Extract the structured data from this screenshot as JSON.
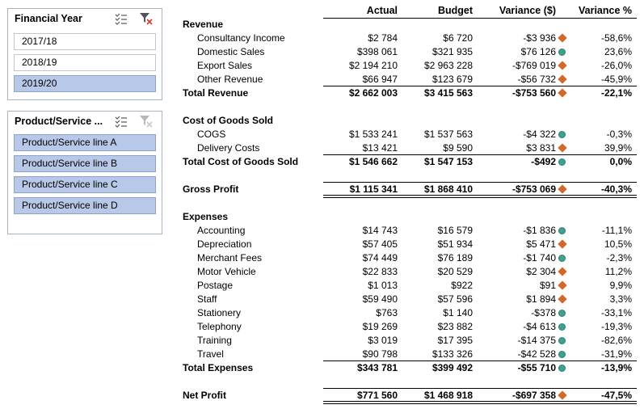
{
  "slicers": [
    {
      "title": "Financial Year",
      "items": [
        {
          "label": "2017/18",
          "selected": false
        },
        {
          "label": "2018/19",
          "selected": false
        },
        {
          "label": "2019/20",
          "selected": true
        }
      ]
    },
    {
      "title": "Product/Service ...",
      "items": [
        {
          "label": "Product/Service line A",
          "selected": true
        },
        {
          "label": "Product/Service line B",
          "selected": true
        },
        {
          "label": "Product/Service line C",
          "selected": true
        },
        {
          "label": "Product/Service line D",
          "selected": true
        }
      ]
    }
  ],
  "columns": {
    "actual": "Actual",
    "budget": "Budget",
    "variance": "Variance ($)",
    "variance_pct": "Variance %"
  },
  "indicator_colors": {
    "diamond": "#d0692b",
    "circle": "#41a18e"
  },
  "rows": [
    {
      "type": "section",
      "label": "Revenue"
    },
    {
      "type": "item",
      "label": "Consultancy Income",
      "actual": "$2 784",
      "budget": "$6 720",
      "variance": "-$3 936",
      "indicator": "diamond",
      "pct": "-58,6%"
    },
    {
      "type": "item",
      "label": "Domestic Sales",
      "actual": "$398 061",
      "budget": "$321 935",
      "variance": "$76 126",
      "indicator": "circle",
      "pct": "23,6%"
    },
    {
      "type": "item",
      "label": "Export Sales",
      "actual": "$2 194 210",
      "budget": "$2 963 228",
      "variance": "-$769 019",
      "indicator": "diamond",
      "pct": "-26,0%"
    },
    {
      "type": "item",
      "label": "Other Revenue",
      "actual": "$66 947",
      "budget": "$123 679",
      "variance": "-$56 732",
      "indicator": "diamond",
      "pct": "-45,9%"
    },
    {
      "type": "total",
      "label": "Total Revenue",
      "actual": "$2 662 003",
      "budget": "$3 415 563",
      "variance": "-$753 560",
      "indicator": "diamond",
      "pct": "-22,1%"
    },
    {
      "type": "section",
      "label": "Cost of Goods Sold"
    },
    {
      "type": "item",
      "label": "COGS",
      "actual": "$1 533 241",
      "budget": "$1 537 563",
      "variance": "-$4 322",
      "indicator": "circle",
      "pct": "-0,3%"
    },
    {
      "type": "item",
      "label": "Delivery Costs",
      "actual": "$13 421",
      "budget": "$9 590",
      "variance": "$3 831",
      "indicator": "diamond",
      "pct": "39,9%"
    },
    {
      "type": "total",
      "label": "Total Cost of Goods Sold",
      "actual": "$1 546 662",
      "budget": "$1 547 153",
      "variance": "-$492",
      "indicator": "circle",
      "pct": "0,0%"
    },
    {
      "type": "grand",
      "label": "Gross Profit",
      "actual": "$1 115 341",
      "budget": "$1 868 410",
      "variance": "-$753 069",
      "indicator": "diamond",
      "pct": "-40,3%"
    },
    {
      "type": "section",
      "label": "Expenses"
    },
    {
      "type": "item",
      "label": "Accounting",
      "actual": "$14 743",
      "budget": "$16 579",
      "variance": "-$1 836",
      "indicator": "circle",
      "pct": "-11,1%"
    },
    {
      "type": "item",
      "label": "Depreciation",
      "actual": "$57 405",
      "budget": "$51 934",
      "variance": "$5 471",
      "indicator": "diamond",
      "pct": "10,5%"
    },
    {
      "type": "item",
      "label": "Merchant Fees",
      "actual": "$74 449",
      "budget": "$76 189",
      "variance": "-$1 740",
      "indicator": "circle",
      "pct": "-2,3%"
    },
    {
      "type": "item",
      "label": "Motor Vehicle",
      "actual": "$22 833",
      "budget": "$20 529",
      "variance": "$2 304",
      "indicator": "diamond",
      "pct": "11,2%"
    },
    {
      "type": "item",
      "label": "Postage",
      "actual": "$1 013",
      "budget": "$922",
      "variance": "$91",
      "indicator": "diamond",
      "pct": "9,9%"
    },
    {
      "type": "item",
      "label": "Staff",
      "actual": "$59 490",
      "budget": "$57 596",
      "variance": "$1 894",
      "indicator": "diamond",
      "pct": "3,3%"
    },
    {
      "type": "item",
      "label": "Stationery",
      "actual": "$763",
      "budget": "$1 140",
      "variance": "-$378",
      "indicator": "circle",
      "pct": "-33,1%"
    },
    {
      "type": "item",
      "label": "Telephony",
      "actual": "$19 269",
      "budget": "$23 882",
      "variance": "-$4 613",
      "indicator": "circle",
      "pct": "-19,3%"
    },
    {
      "type": "item",
      "label": "Training",
      "actual": "$3 019",
      "budget": "$17 395",
      "variance": "-$14 375",
      "indicator": "circle",
      "pct": "-82,6%"
    },
    {
      "type": "item",
      "label": "Travel",
      "actual": "$90 798",
      "budget": "$133 326",
      "variance": "-$42 528",
      "indicator": "circle",
      "pct": "-31,9%"
    },
    {
      "type": "total",
      "label": "Total Expenses",
      "actual": "$343 781",
      "budget": "$399 492",
      "variance": "-$55 710",
      "indicator": "circle",
      "pct": "-13,9%"
    },
    {
      "type": "grand",
      "label": "Net Profit",
      "actual": "$771 560",
      "budget": "$1 468 918",
      "variance": "-$697 358",
      "indicator": "diamond",
      "pct": "-47,5%"
    }
  ]
}
